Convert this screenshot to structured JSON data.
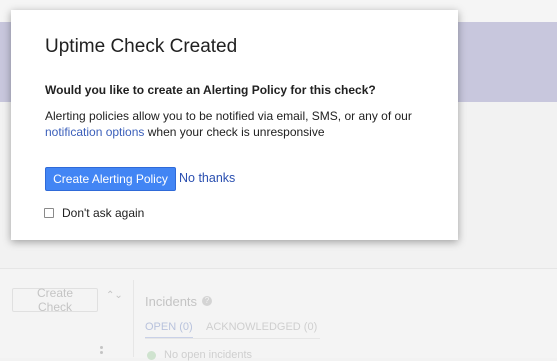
{
  "background": {
    "create_check_label": "Create Check",
    "sort_glyph": "⌃⌄",
    "incidents_label": "Incidents",
    "help_glyph": "?",
    "tabs": [
      {
        "label": "OPEN (0)"
      },
      {
        "label": "ACKNOWLEDGED (0)"
      }
    ],
    "no_incidents_label": "No open incidents"
  },
  "dialog": {
    "title": "Uptime Check Created",
    "question": "Would you like to create an Alerting Policy for this check?",
    "description_before": "Alerting policies allow you to be notified via email, SMS, or any of our ",
    "link_label": "notification options",
    "description_after": " when your check is unresponsive",
    "primary_button": "Create Alerting Policy",
    "secondary_button": "No thanks",
    "checkbox_label": "Don't ask again",
    "checkbox_checked": false
  },
  "colors": {
    "primary": "#4285f4",
    "link": "#3b5fba",
    "banner": "#c8c7dd"
  }
}
